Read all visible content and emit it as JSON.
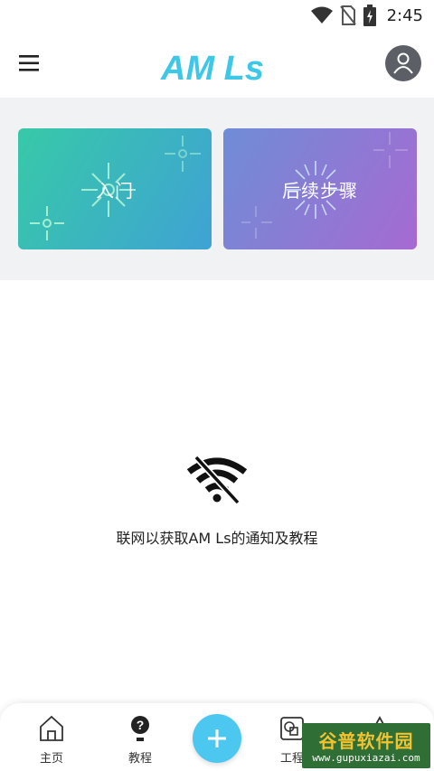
{
  "status_bar": {
    "time": "2:45"
  },
  "app_bar": {
    "logo_text": "AM Ls"
  },
  "cards": [
    {
      "label": "入门"
    },
    {
      "label": "后续步骤"
    }
  ],
  "offline": {
    "message": "联网以获取AM Ls的通知及教程"
  },
  "bottom_nav": {
    "home": "主页",
    "tutorial": "教程",
    "project": "工程"
  },
  "watermark": {
    "title": "谷普软件园",
    "url": "www.gupuxiazai.com"
  },
  "colors": {
    "card_start_gradient": [
      "#37c9a8",
      "#3fa2d4"
    ],
    "card_next_gradient": [
      "#6f8dd6",
      "#a66ad2"
    ],
    "fab": "#4cc7f0",
    "logo": "#3fc7e8"
  }
}
